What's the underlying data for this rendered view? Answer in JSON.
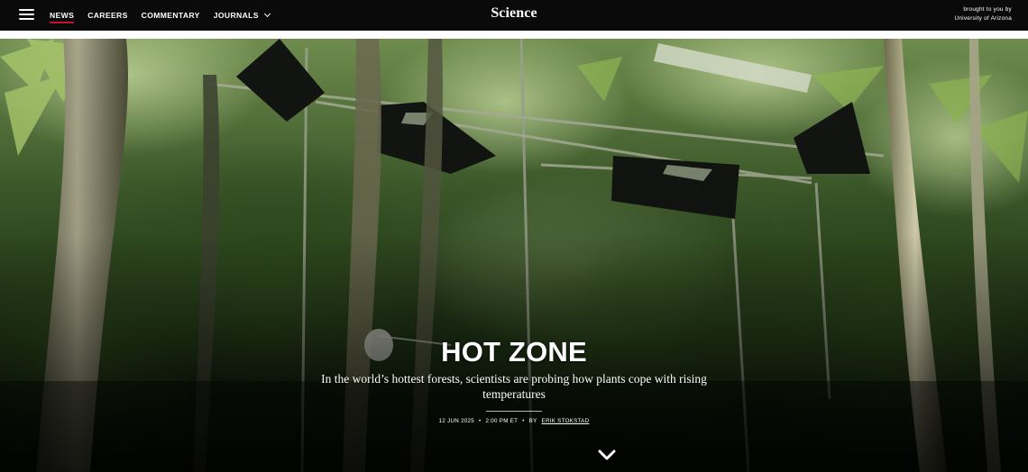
{
  "nav": {
    "items": [
      {
        "label": "NEWS",
        "active": true
      },
      {
        "label": "CAREERS"
      },
      {
        "label": "COMMENTARY"
      },
      {
        "label": "JOURNALS",
        "has_dropdown": true
      }
    ],
    "menu_icon": "hamburger-menu-icon",
    "logo": "Science",
    "sponsor_line1": "brought to you by",
    "sponsor_line2": "University of Arizona",
    "accent_color": "#c8102e"
  },
  "article": {
    "headline": "HOT ZONE",
    "dek": "In the world’s hottest forests, scientists are probing how plants cope with rising temperatures",
    "date": "12 JUN 2025",
    "time": "2:00 PM ET",
    "by": "BY",
    "author": "ERIK STOKSTAD",
    "separator": "•",
    "scroll_icon": "chevron-down-icon"
  }
}
